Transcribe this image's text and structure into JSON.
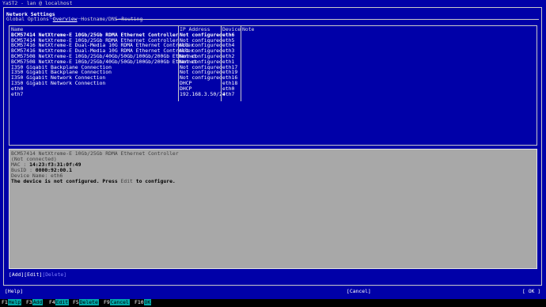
{
  "window_title": "YaST2 - lan @ localhost",
  "dialog_title": "Network Settings",
  "tabs": [
    "Global Options",
    "Overview",
    "Hostname/DNS",
    "Routing"
  ],
  "table": {
    "headers": [
      "Name",
      "IP Address",
      "Device",
      "Note"
    ],
    "rows": [
      [
        "BCM57414 NetXtreme-E 10Gb/25Gb RDMA Ethernet Controller",
        "Not configured",
        "eth6",
        ""
      ],
      [
        "BCM57414 NetXtreme-E 10Gb/25Gb RDMA Ethernet Controller",
        "Not configured",
        "eth5",
        ""
      ],
      [
        "BCM57416 NetXtreme-E Dual-Media 10G RDMA Ethernet Controller",
        "Not configured",
        "eth4",
        ""
      ],
      [
        "BCM57416 NetXtreme-E Dual-Media 10G RDMA Ethernet Controller",
        "Not configured",
        "eth3",
        ""
      ],
      [
        "BCM57508 NetXtreme-E 10Gb/25Gb/40Gb/50Gb/100Gb/200Gb Ethernet",
        "Not configured",
        "eth2",
        ""
      ],
      [
        "BCM57508 NetXtreme-E 10Gb/25Gb/40Gb/50Gb/100Gb/200Gb Ethernet",
        "Not configured",
        "eth1",
        ""
      ],
      [
        "I350 Gigabit Backplane Connection",
        "Not configured",
        "eth17",
        ""
      ],
      [
        "I350 Gigabit Backplane Connection",
        "Not configured",
        "eth19",
        ""
      ],
      [
        "I350 Gigabit Network Connection",
        "Not configured",
        "eth16",
        ""
      ],
      [
        "I350 Gigabit Network Connection",
        "DHCP",
        "eth18",
        ""
      ],
      [
        "eth0",
        "DHCP",
        "eth0",
        ""
      ],
      [
        "eth7",
        "192.168.3.50/24",
        "eth7",
        ""
      ]
    ]
  },
  "details": {
    "name": "BCM57414 NetXtreme-E 10Gb/25Gb RDMA Ethernet Controller",
    "status": "(Not connected)",
    "mac_label": "MAC : ",
    "mac_value": "14:23:f3:31:0f:49",
    "busid_label": "BusID : ",
    "busid_value": "0000:92:00.1",
    "device_name": "Device Name: eth6",
    "message_pre": "The device is not configured. Press ",
    "message_edit": "Edit",
    "message_post": " to configure."
  },
  "actions": {
    "add": "[Add]",
    "edit": "[Edit]",
    "delete": "[Delete]"
  },
  "buttons": {
    "help": "[Help]",
    "cancel": "[Cancel]",
    "ok": "[ OK ]"
  },
  "fkeys": [
    {
      "key": "F1",
      "label": "Help"
    },
    {
      "key": "F3",
      "label": "Add"
    },
    {
      "key": "F4",
      "label": "Edit"
    },
    {
      "key": "F5",
      "label": "Delete"
    },
    {
      "key": "F9",
      "label": "Cancel"
    },
    {
      "key": "F10",
      "label": "OK"
    }
  ]
}
